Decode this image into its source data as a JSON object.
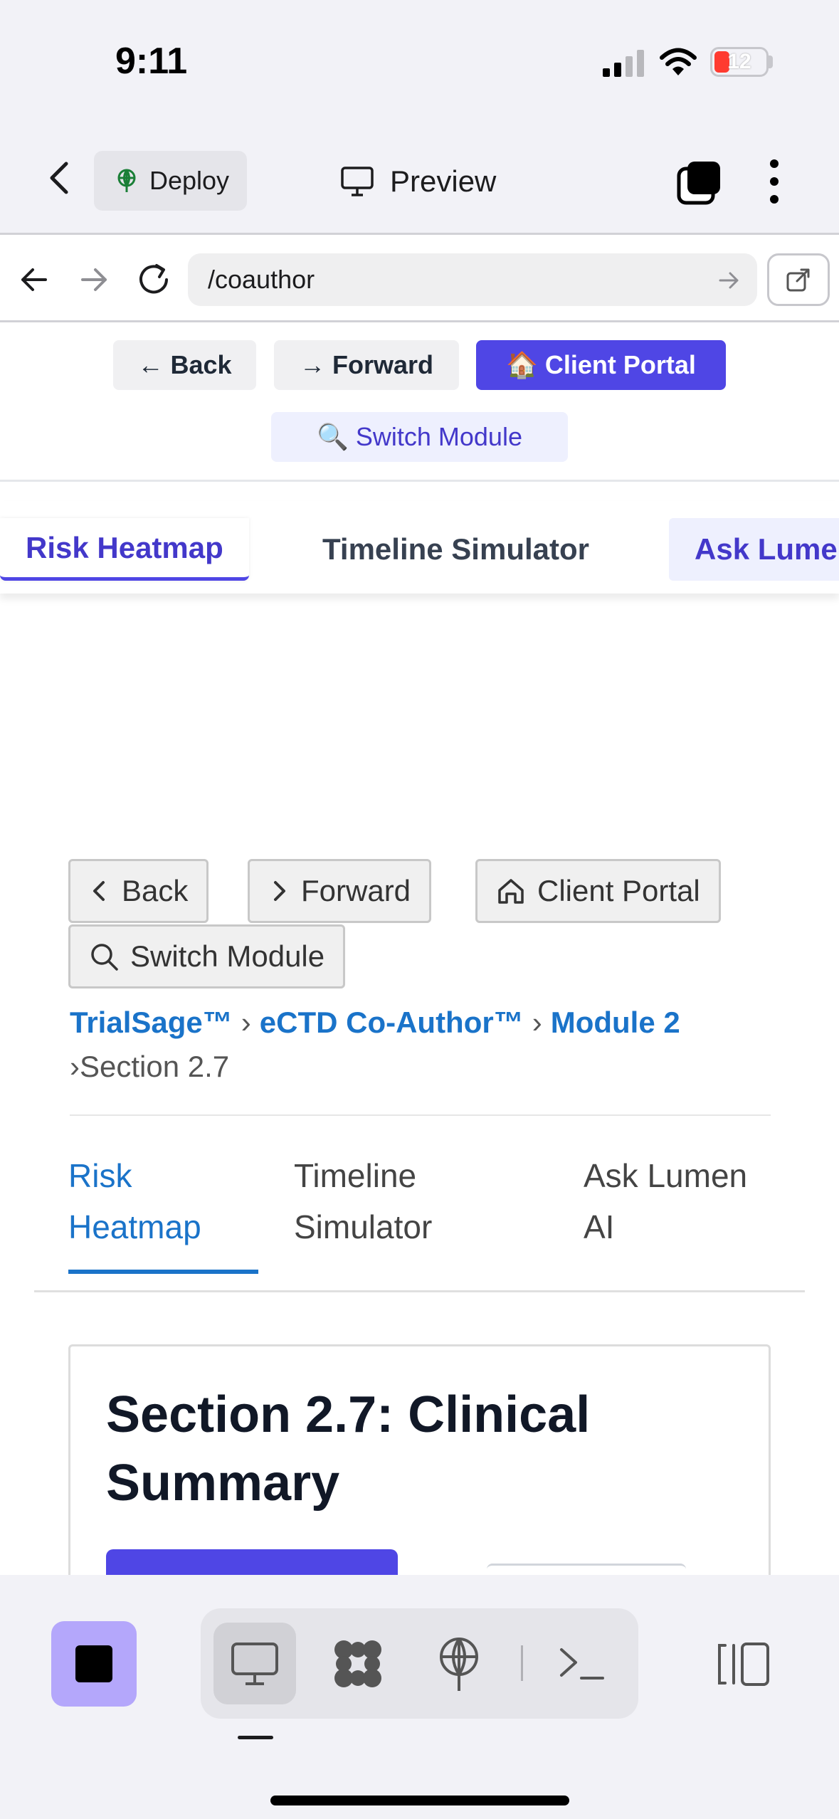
{
  "status_bar": {
    "time": "9:11",
    "battery": "12"
  },
  "app_header": {
    "deploy_label": "Deploy",
    "preview_label": "Preview"
  },
  "browser": {
    "url": "/coauthor"
  },
  "top_nav": {
    "back": "← Back",
    "forward": "→ Forward",
    "client_portal": "🏠 Client Portal",
    "switch_module": "🔍 Switch Module"
  },
  "module_tabs": [
    "Risk Heatmap",
    "Timeline Simulator",
    "Ask Lume"
  ],
  "inner_nav": {
    "back": "Back",
    "forward": "Forward",
    "client_portal": "Client Portal",
    "switch_module": "Switch Module"
  },
  "breadcrumb": {
    "items": [
      "TrialSage™",
      "eCTD Co-Author™",
      "Module 2"
    ],
    "separator": "›",
    "current": "›Section 2.7"
  },
  "inner_tabs": {
    "tab1_line1": "Risk",
    "tab1_line2": "Heatmap",
    "tab2_line1": "Timeline",
    "tab2_line2": "Simulator",
    "tab3_line1": "Ask Lumen",
    "tab3_line2": "AI"
  },
  "section": {
    "title": "Section 2.7: Clinical Summary"
  },
  "colors": {
    "primary": "#4f46e5",
    "link": "#1a73c9",
    "stop_button": "#b4a7fb"
  }
}
